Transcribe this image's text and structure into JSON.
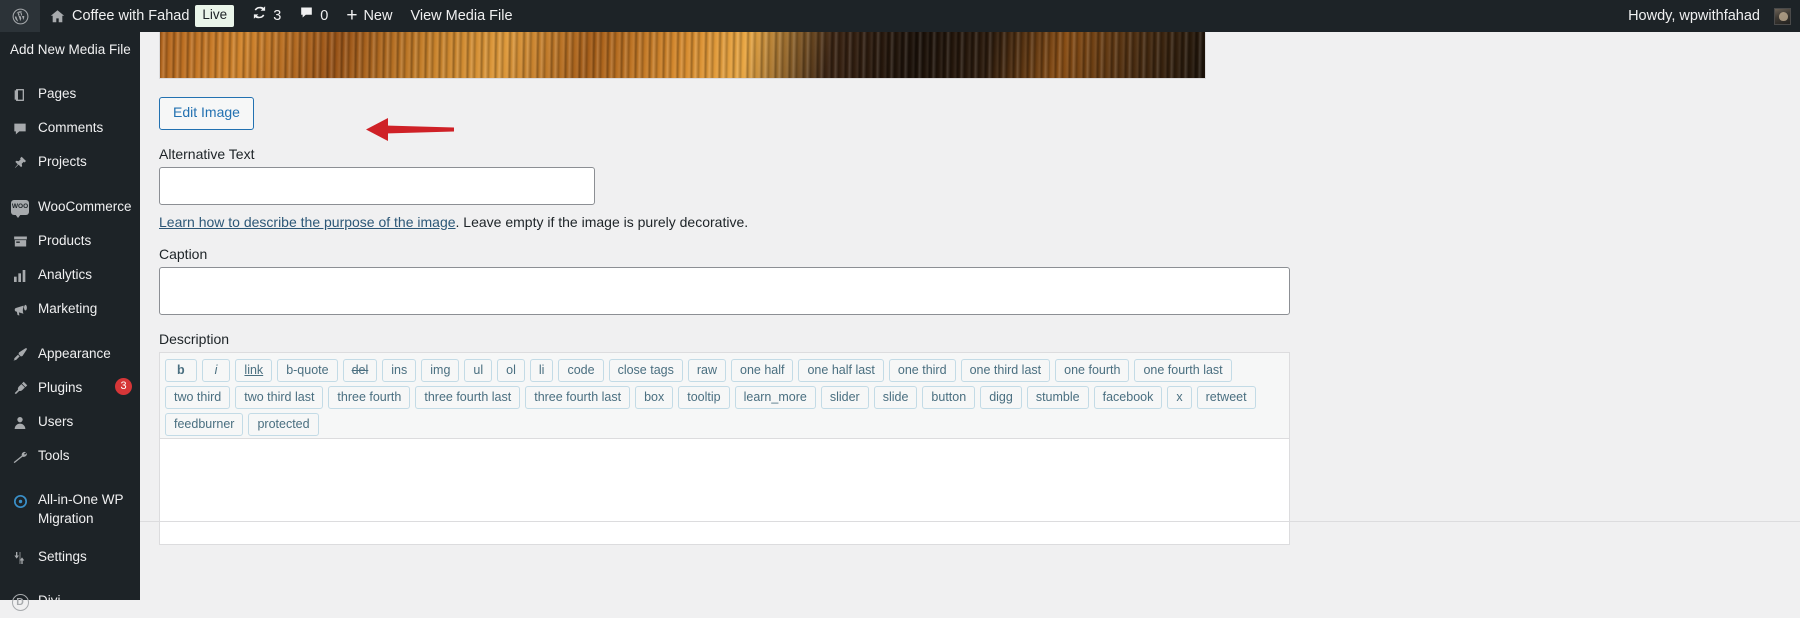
{
  "adminbar": {
    "logo_icon": "wordpress-logo-icon",
    "home_icon": "home-icon",
    "site_name": "Coffee with Fahad",
    "live_badge": "Live",
    "updates_icon": "updates-icon",
    "updates_count": "3",
    "comments_icon": "comment-bubble-icon",
    "comments_count": "0",
    "new_icon": "plus-icon",
    "new_label": "New",
    "view_media_label": "View Media File",
    "howdy": "Howdy, wpwithfahad",
    "avatar_icon": "user-avatar"
  },
  "sidebar": {
    "current_page_title": "Add New Media File",
    "items": [
      {
        "label": "Pages",
        "icon": "pages-icon",
        "badge": ""
      },
      {
        "label": "Comments",
        "icon": "comments-icon",
        "badge": ""
      },
      {
        "label": "Projects",
        "icon": "pin-icon",
        "badge": ""
      },
      {
        "label": "WooCommerce",
        "icon": "woocommerce-icon",
        "badge": ""
      },
      {
        "label": "Products",
        "icon": "products-icon",
        "badge": ""
      },
      {
        "label": "Analytics",
        "icon": "analytics-bar-icon",
        "badge": ""
      },
      {
        "label": "Marketing",
        "icon": "megaphone-icon",
        "badge": ""
      },
      {
        "label": "Appearance",
        "icon": "paintbrush-icon",
        "badge": ""
      },
      {
        "label": "Plugins",
        "icon": "plug-icon",
        "badge": "3"
      },
      {
        "label": "Users",
        "icon": "user-icon",
        "badge": ""
      },
      {
        "label": "Tools",
        "icon": "wrench-icon",
        "badge": ""
      },
      {
        "label": "All-in-One WP Migration",
        "icon": "migration-icon",
        "badge": ""
      },
      {
        "label": "Settings",
        "icon": "settings-sliders-icon",
        "badge": ""
      },
      {
        "label": "Divi",
        "icon": "divi-icon",
        "badge": ""
      }
    ]
  },
  "main": {
    "preview_image_alt": "blurred-orange-wood-streak-image",
    "edit_image_button": "Edit Image",
    "annotation": {
      "type": "red-arrow-pointing-left",
      "color": "#cf2127",
      "target": "Edit Image"
    },
    "alt_text": {
      "label": "Alternative Text",
      "value": "",
      "placeholder": ""
    },
    "alt_help": {
      "link_text": "Learn how to describe the purpose of the image",
      "rest_text": ". Leave empty if the image is purely decorative."
    },
    "caption": {
      "label": "Caption",
      "value": "",
      "placeholder": ""
    },
    "description": {
      "label": "Description",
      "value": "",
      "quicktags_row1": [
        {
          "label": "b",
          "style": "b"
        },
        {
          "label": "i",
          "style": "i"
        },
        {
          "label": "link",
          "style": "u"
        },
        {
          "label": "b-quote",
          "style": ""
        },
        {
          "label": "del",
          "style": "s"
        },
        {
          "label": "ins",
          "style": ""
        },
        {
          "label": "img",
          "style": ""
        },
        {
          "label": "ul",
          "style": ""
        },
        {
          "label": "ol",
          "style": ""
        },
        {
          "label": "li",
          "style": ""
        },
        {
          "label": "code",
          "style": ""
        },
        {
          "label": "close tags",
          "style": ""
        },
        {
          "label": "raw",
          "style": ""
        },
        {
          "label": "one half",
          "style": ""
        },
        {
          "label": "one half last",
          "style": ""
        },
        {
          "label": "one third",
          "style": ""
        },
        {
          "label": "one third last",
          "style": ""
        },
        {
          "label": "one fourth",
          "style": ""
        },
        {
          "label": "one fourth last",
          "style": ""
        },
        {
          "label": "two third",
          "style": ""
        },
        {
          "label": "two third last",
          "style": ""
        },
        {
          "label": "three fourth",
          "style": ""
        }
      ],
      "quicktags_row2": [
        {
          "label": "three fourth last",
          "style": ""
        },
        {
          "label": "three fourth last",
          "style": ""
        },
        {
          "label": "box",
          "style": ""
        },
        {
          "label": "tooltip",
          "style": ""
        },
        {
          "label": "learn_more",
          "style": ""
        },
        {
          "label": "slider",
          "style": ""
        },
        {
          "label": "slide",
          "style": ""
        },
        {
          "label": "button",
          "style": ""
        },
        {
          "label": "digg",
          "style": ""
        },
        {
          "label": "stumble",
          "style": ""
        },
        {
          "label": "facebook",
          "style": ""
        },
        {
          "label": "x",
          "style": ""
        },
        {
          "label": "retweet",
          "style": ""
        },
        {
          "label": "feedburner",
          "style": ""
        },
        {
          "label": "protected",
          "style": ""
        }
      ]
    }
  },
  "colors": {
    "admin_bg": "#1d2327",
    "page_bg": "#f0f0f1",
    "link": "#2271b1",
    "badge_red": "#d63638",
    "annotation_red": "#cf2127",
    "quicktag_border": "#c3dbe6",
    "quicktag_text": "#4a6f80"
  }
}
